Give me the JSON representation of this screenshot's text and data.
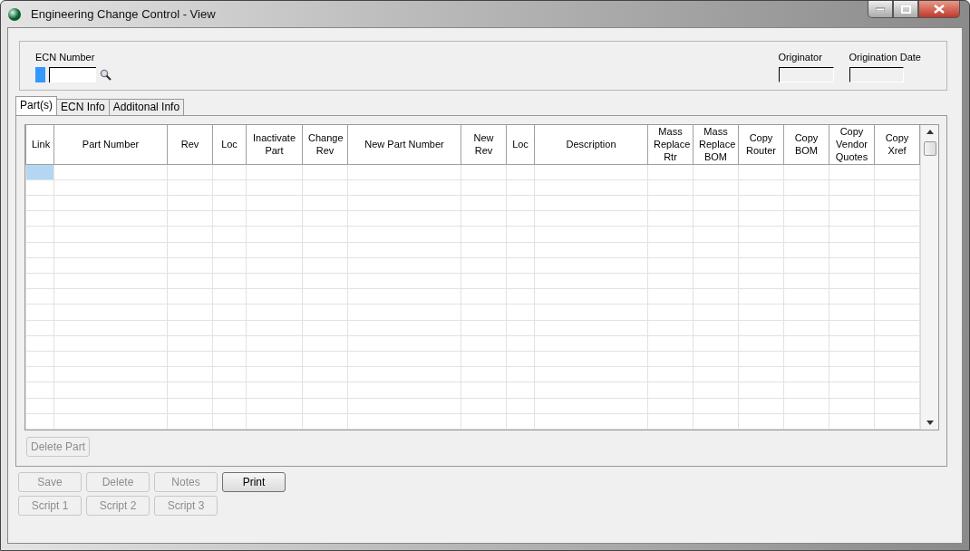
{
  "window": {
    "title": "Engineering Change Control - View"
  },
  "header": {
    "ecn_number": {
      "label": "ECN Number"
    },
    "originator": {
      "label": "Originator"
    },
    "origination_date": {
      "label": "Origination Date"
    }
  },
  "tabs": [
    {
      "label": "Part(s)",
      "selected": true
    },
    {
      "label": "ECN Info",
      "selected": false
    },
    {
      "label": "Additonal Info",
      "selected": false
    }
  ],
  "table": {
    "columns": [
      "Link",
      "Part Number",
      "Rev",
      "Loc",
      "Inactivate Part",
      "Change Rev",
      "New Part Number",
      "New Rev",
      "Loc",
      "Description",
      "Mass Replace Rtr",
      "Mass Replace BOM",
      "Copy Router",
      "Copy BOM",
      "Copy Vendor Quotes",
      "Copy Xref"
    ],
    "rows": [
      {
        "selected": true
      },
      {
        "selected": false
      },
      {
        "selected": false
      },
      {
        "selected": false
      },
      {
        "selected": false
      },
      {
        "selected": false
      },
      {
        "selected": false
      },
      {
        "selected": false
      },
      {
        "selected": false
      },
      {
        "selected": false
      },
      {
        "selected": false
      },
      {
        "selected": false
      },
      {
        "selected": false
      },
      {
        "selected": false
      },
      {
        "selected": false
      },
      {
        "selected": false
      },
      {
        "selected": false
      }
    ]
  },
  "panel_buttons": [
    {
      "label": "Delete Part",
      "disabled": true
    }
  ],
  "buttons": [
    [
      {
        "label": "Save",
        "disabled": true
      },
      {
        "label": "Delete",
        "disabled": true
      },
      {
        "label": "Notes",
        "disabled": true
      },
      {
        "label": "Print",
        "disabled": false
      }
    ],
    [
      {
        "label": "Script 1",
        "disabled": true
      },
      {
        "label": "Script 2",
        "disabled": true
      },
      {
        "label": "Script 3",
        "disabled": true
      }
    ]
  ]
}
